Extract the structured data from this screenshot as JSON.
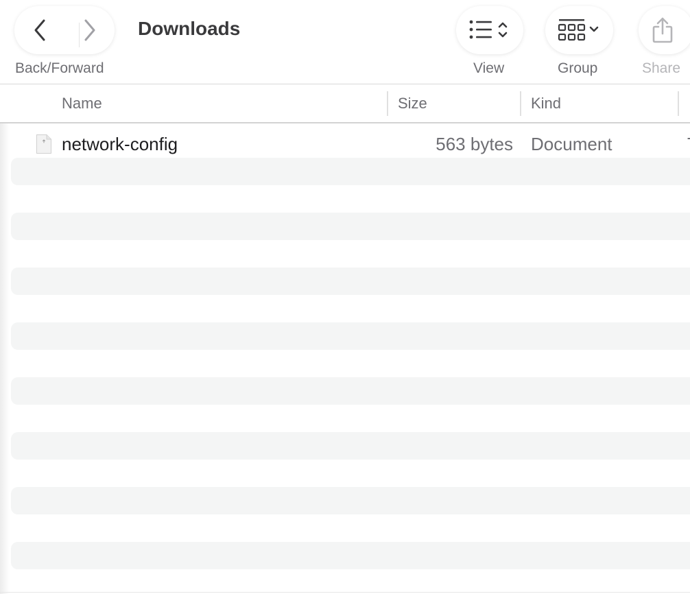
{
  "toolbar": {
    "back_forward_label": "Back/Forward",
    "title": "Downloads",
    "view_label": "View",
    "group_label": "Group",
    "share_label": "Share",
    "icons": {
      "back": "chevron-left-icon",
      "forward": "chevron-right-icon",
      "view": "list-view-icon",
      "group": "grid-group-icon",
      "share": "share-icon"
    }
  },
  "columns": {
    "name": "Name",
    "size": "Size",
    "kind": "Kind"
  },
  "files": [
    {
      "name": "network-config",
      "size": "563 bytes",
      "kind": "Document",
      "extra": "T"
    }
  ],
  "colors": {
    "stripe": "#f4f5f5",
    "title": "#3a3a3c",
    "secondary_text": "#6e6e73",
    "disabled_text": "#b5b5b8"
  }
}
